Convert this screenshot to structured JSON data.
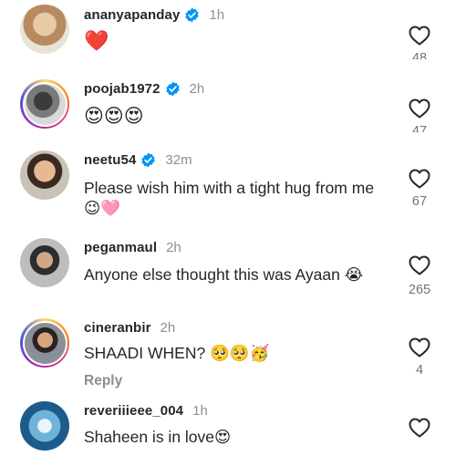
{
  "comments": [
    {
      "username": "ananyapanday",
      "verified": true,
      "time": "1h",
      "text": "❤️",
      "likes": "48",
      "reply": ""
    },
    {
      "username": "poojab1972",
      "verified": true,
      "time": "2h",
      "text": "😍😍😍",
      "likes": "47",
      "reply": ""
    },
    {
      "username": "neetu54",
      "verified": true,
      "time": "32m",
      "text": "Please wish him with a tight hug from me 😉🩷",
      "likes": "67",
      "reply": ""
    },
    {
      "username": "peganmaul",
      "verified": false,
      "time": "2h",
      "text": "Anyone else thought this was Ayaan 😭",
      "likes": "265",
      "reply": ""
    },
    {
      "username": "cineranbir",
      "verified": false,
      "time": "2h",
      "text": "SHAADI WHEN? 🥺🥺🥳",
      "likes": "4",
      "reply": "Reply"
    },
    {
      "username": "reveriiieee_004",
      "verified": false,
      "time": "1h",
      "text": "Shaheen is in love😍",
      "likes": "",
      "reply": ""
    }
  ],
  "icons": {
    "verified": "verified-badge-icon",
    "like": "heart-outline-icon"
  },
  "colors": {
    "verified": "#0095f6",
    "heart_red": "#ed4956",
    "muted": "#8e8e8e"
  }
}
